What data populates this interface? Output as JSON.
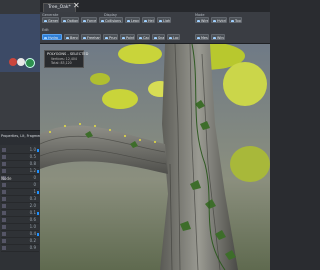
{
  "window": {
    "doc_tab": "Tree_Oak*",
    "close_icon": "close-icon"
  },
  "toolbar": {
    "groups": {
      "generate": "Generate",
      "edit": "Edit",
      "display": "Display",
      "mode": "Mode"
    },
    "buttons": [
      {
        "label": "Generate"
      },
      {
        "label": "Options"
      },
      {
        "label": "Forces"
      },
      {
        "label": "Collisions"
      },
      {
        "label": "Leaves"
      },
      {
        "label": "Help"
      },
      {
        "label": "Light"
      },
      {
        "label": "Wire"
      },
      {
        "label": "Hybrid"
      },
      {
        "label": "Tools"
      },
      {
        "label": "Hydro"
      },
      {
        "label": "Bend"
      },
      {
        "label": "Freehand"
      },
      {
        "label": "Prune"
      },
      {
        "label": "Points"
      },
      {
        "label": "Cage"
      },
      {
        "label": "Snap"
      },
      {
        "label": "Lock"
      },
      {
        "label": "Mesh"
      },
      {
        "label": "Wind"
      }
    ],
    "accent": "#2f7fd6"
  },
  "left_panel": {
    "tabs_text": "Properties, Lit, Fragments, Parameters",
    "section_label": "Node",
    "prop_values": [
      "1.0",
      "0.5",
      "0.8",
      "1.2",
      "0",
      "0",
      "1",
      "0.3",
      "2.0",
      "0.1",
      "0.6",
      "1.0",
      "0.4",
      "0.2",
      "0.9"
    ]
  },
  "viewport": {
    "hud_title": "POLYGONS - SELECTED",
    "hud_line1": "Vertices: 12,404",
    "hud_line2": "Total: 83,120"
  }
}
